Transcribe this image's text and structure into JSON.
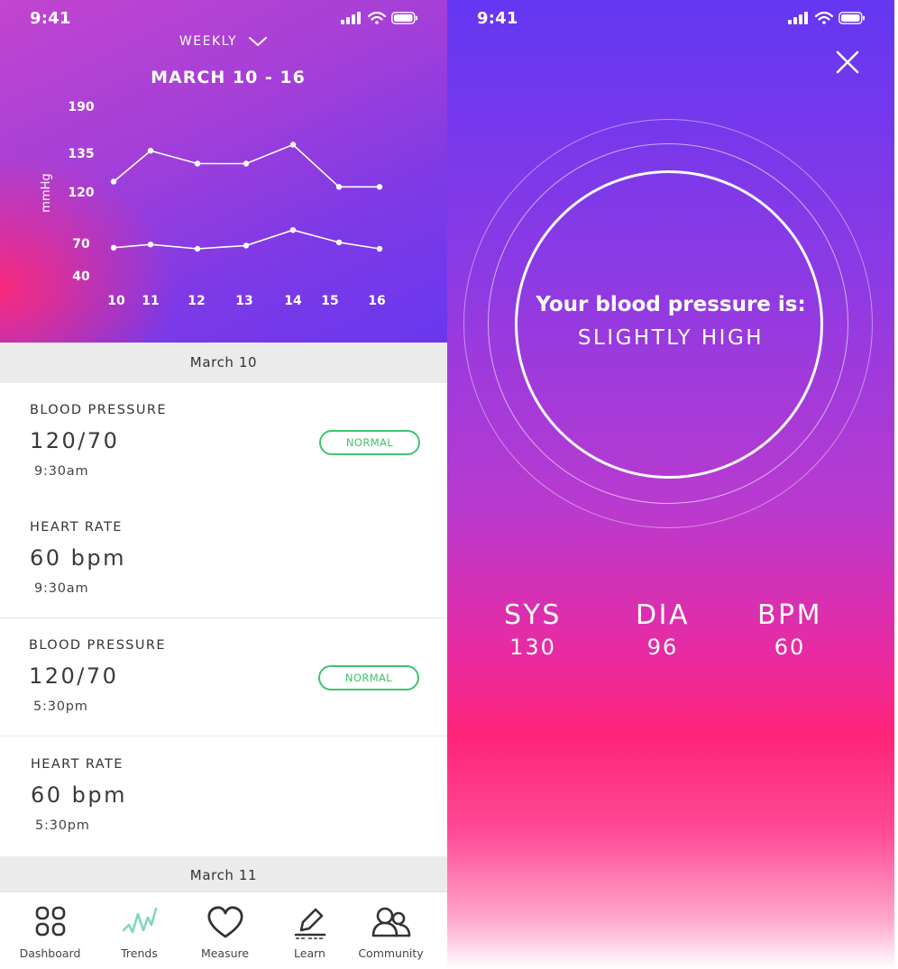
{
  "left": {
    "status": {
      "time": "9:41"
    },
    "period_label": "WEEKLY",
    "range_title": "MARCH 10 - 16",
    "chart_data": {
      "type": "line",
      "ylabel": "mmHg",
      "x": [
        10,
        11,
        12,
        13,
        14,
        15,
        16
      ],
      "y_ticks": [
        190,
        135,
        120,
        70,
        40
      ],
      "series": [
        {
          "values": [
            124,
            138,
            131,
            131,
            145,
            122,
            122
          ]
        },
        {
          "values": [
            66,
            69,
            65,
            68,
            83,
            71,
            65
          ]
        }
      ]
    },
    "day_headers": [
      "March 10",
      "March 11"
    ],
    "records": [
      {
        "label": "BLOOD PRESSURE",
        "value": "120/70",
        "time": "9:30am",
        "badge": "NORMAL"
      },
      {
        "label": "HEART RATE",
        "value": "60 bpm",
        "time": "9:30am",
        "badge": ""
      },
      {
        "label": "BLOOD PRESSURE",
        "value": "120/70",
        "time": "5:30pm",
        "badge": "NORMAL"
      },
      {
        "label": "HEART RATE",
        "value": "60 bpm",
        "time": "5:30pm",
        "badge": ""
      }
    ],
    "tabs": [
      {
        "label": "Dashboard",
        "icon": "grid-icon"
      },
      {
        "label": "Trends",
        "icon": "pulse-icon"
      },
      {
        "label": "Measure",
        "icon": "heart-icon"
      },
      {
        "label": "Learn",
        "icon": "pen-icon"
      },
      {
        "label": "Community",
        "icon": "people-icon"
      }
    ],
    "colors": {
      "normal_badge": "#3ec46d",
      "trends_active": "#7fd8b6"
    }
  },
  "right": {
    "status": {
      "time": "9:41"
    },
    "message_line1": "Your blood pressure is:",
    "message_line2": "SLIGHTLY HIGH",
    "stats": [
      {
        "label": "SYS",
        "value": "130"
      },
      {
        "label": "DIA",
        "value": "96"
      },
      {
        "label": "BPM",
        "value": "60"
      }
    ]
  }
}
